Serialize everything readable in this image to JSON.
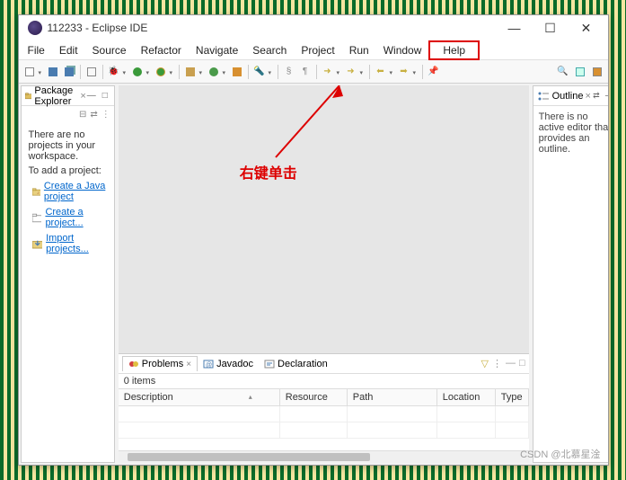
{
  "window": {
    "title": "112233 - Eclipse IDE"
  },
  "menu": [
    "File",
    "Edit",
    "Source",
    "Refactor",
    "Navigate",
    "Search",
    "Project",
    "Run",
    "Window",
    "Help"
  ],
  "package_explorer": {
    "tab_label": "Package Explorer",
    "msg1": "There are no projects in your workspace.",
    "msg2": "To add a project:",
    "links": [
      {
        "label": "Create a Java project"
      },
      {
        "label": "Create a project..."
      },
      {
        "label": "Import projects..."
      }
    ]
  },
  "outline": {
    "tab_label": "Outline",
    "msg": "There is no active editor that provides an outline."
  },
  "problems": {
    "tabs": [
      "Problems",
      "Javadoc",
      "Declaration"
    ],
    "items_label": "0 items",
    "columns": [
      "Description",
      "Resource",
      "Path",
      "Location",
      "Type"
    ]
  },
  "annotation": {
    "text": "右键单击"
  },
  "watermark": "CSDN @北慕星淦"
}
